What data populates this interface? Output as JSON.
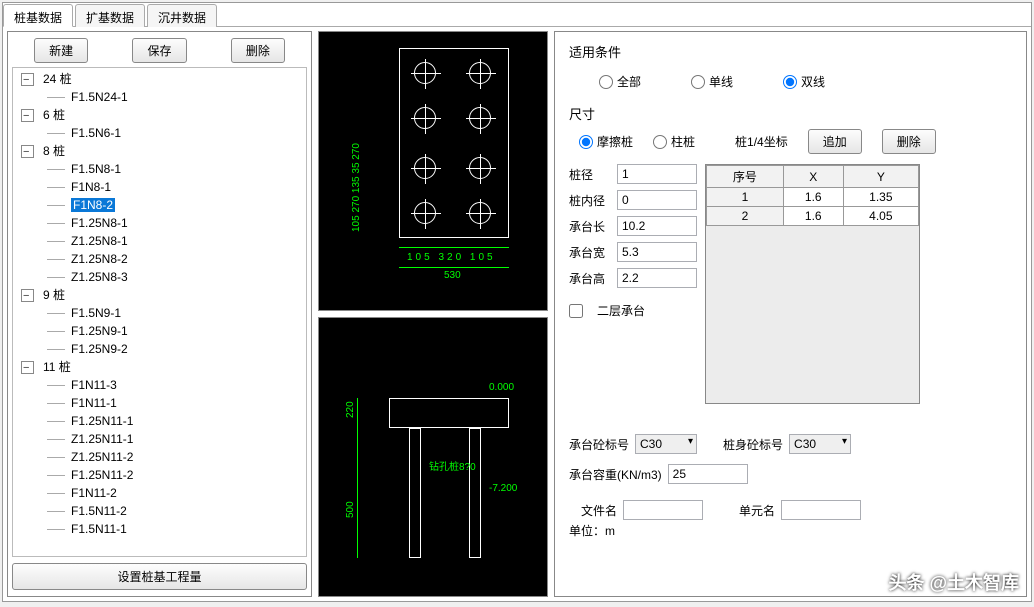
{
  "tabs": [
    "桩基数据",
    "扩基数据",
    "沉井数据"
  ],
  "toolbar": {
    "new": "新建",
    "save": "保存",
    "delete": "删除"
  },
  "tree": {
    "groups": [
      {
        "label": "24 桩",
        "items": [
          "F1.5N24-1"
        ]
      },
      {
        "label": "6 桩",
        "items": [
          "F1.5N6-1"
        ]
      },
      {
        "label": "8 桩",
        "items": [
          "F1.5N8-1",
          "F1N8-1",
          "F1N8-2",
          "F1.25N8-1",
          "Z1.25N8-1",
          "Z1.25N8-2",
          "Z1.25N8-3"
        ]
      },
      {
        "label": "9 桩",
        "items": [
          "F1.5N9-1",
          "F1.25N9-1",
          "F1.25N9-2"
        ]
      },
      {
        "label": "11 桩",
        "items": [
          "F1N11-3",
          "F1N11-1",
          "F1.25N11-1",
          "Z1.25N11-1",
          "Z1.25N11-2",
          "F1.25N11-2",
          "F1N11-2",
          "F1.5N11-2",
          "F1.5N11-1"
        ]
      }
    ],
    "selected": "F1N8-2"
  },
  "bottom_button": "设置桩基工程量",
  "applicable": {
    "title": "适用条件",
    "opts": [
      "全部",
      "单线",
      "双线"
    ],
    "selected": "双线"
  },
  "dimensions": {
    "title": "尺寸",
    "pile_type": {
      "opts": [
        "摩擦桩",
        "柱桩"
      ],
      "selected": "摩擦桩"
    },
    "coord_label": "桩1/4坐标",
    "add_btn": "追加",
    "del_btn": "删除",
    "fields": {
      "diameter_label": "桩径",
      "diameter": "1",
      "inner_label": "桩内径",
      "inner": "0",
      "cap_len_label": "承台长",
      "cap_len": "10.2",
      "cap_wid_label": "承台宽",
      "cap_wid": "5.3",
      "cap_hgt_label": "承台高",
      "cap_hgt": "2.2",
      "two_layer_label": "二层承台"
    },
    "coord_table": {
      "headers": [
        "序号",
        "X",
        "Y"
      ],
      "rows": [
        {
          "no": "1",
          "x": "1.6",
          "y": "1.35"
        },
        {
          "no": "2",
          "x": "1.6",
          "y": "4.05"
        }
      ]
    }
  },
  "materials": {
    "cap_conc_label": "承台砼标号",
    "cap_conc": "C30",
    "pile_conc_label": "桩身砼标号",
    "pile_conc": "C30",
    "unit_weight_label": "承台容重(KN/m3)",
    "unit_weight": "25",
    "file_label": "文件名",
    "unit_label": "单元名",
    "unit_note": "单位：m"
  },
  "plan_dims": {
    "left_vals": "105 270 135 35 270",
    "bot_vals": "105 320 105",
    "total": "530"
  },
  "elev_dims": {
    "h1": "220",
    "h2": "500",
    "top_lvl": "0.000",
    "drill": "钻孔桩8?0",
    "bot_lvl": "-7.200"
  },
  "watermark": "头条 @土木智库"
}
